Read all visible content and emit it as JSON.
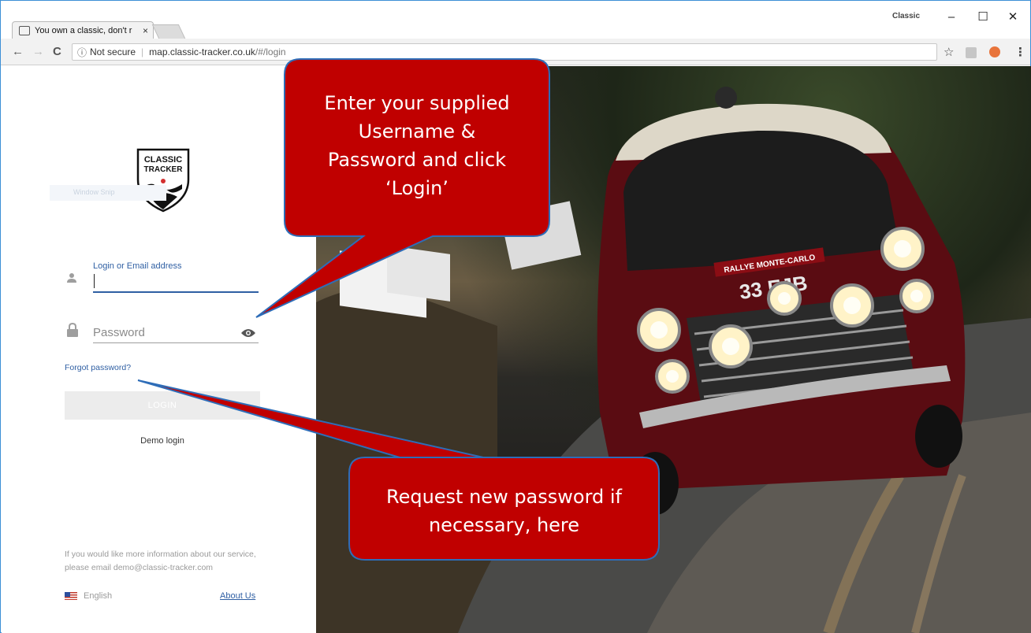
{
  "browser": {
    "tab_title": "You own a classic, don't r",
    "tab_close": "×",
    "profile_label": "Classic",
    "window_buttons": [
      "–",
      "☐",
      "✕"
    ],
    "address": {
      "security": "Not secure",
      "host": "map.classic-tracker.co.uk",
      "path": "/#/login"
    }
  },
  "logo": {
    "line1": "CLASSIC",
    "line2": "TRACKER"
  },
  "strip_label": "Window Snip",
  "login_form": {
    "username_label": "Login or Email address",
    "username_value": "",
    "password_placeholder": "Password",
    "forgot_password": "Forgot password?",
    "login_button": "LOGIN",
    "demo_login": "Demo login"
  },
  "footer": {
    "info_text": "If you would like more information about our service, please email demo@classic-tracker.com",
    "language": "English",
    "about_link": "About Us"
  },
  "callouts": [
    {
      "lines": [
        "Enter your supplied",
        "Username &",
        "Password and click",
        "‘Login’"
      ]
    },
    {
      "lines": [
        "Request new password if",
        "necessary, here"
      ]
    }
  ],
  "photo": {
    "car_plate": "33 EJB",
    "rally_plate": "RALLYE MONTE-CARLO"
  },
  "colors": {
    "accent": "#2f5fa3",
    "callout_fill": "#c00000",
    "callout_stroke": "#2e6db8",
    "car_body": "#5a0c12"
  }
}
